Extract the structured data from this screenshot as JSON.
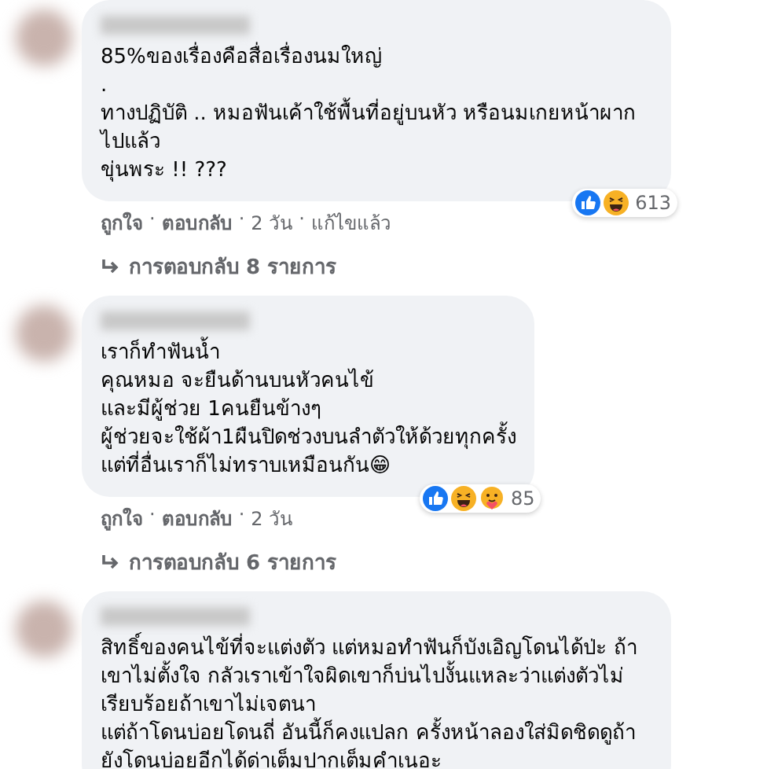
{
  "separator": "·",
  "comments": [
    {
      "lines": [
        "85%ของเรื่องคือสื่อเรื่องนมใหญ่",
        ".",
        "ทางปฏิบัติ .. หมอฟันเค้าใช้พื้นที่อยู่บนหัว หรือนมเกยหน้าผากไปแล้ว",
        "ขุ่นพระ !! ???"
      ],
      "reactions": [
        {
          "kind": "like"
        },
        {
          "kind": "haha"
        }
      ],
      "count": "613",
      "actions": [
        "ถูกใจ",
        "ตอบกลับ",
        "2 วัน",
        "แก้ไขแล้ว"
      ],
      "replies": "การตอบกลับ 8 รายการ"
    },
    {
      "lines": [
        "เราก็ทำฟันนํ้า",
        "คุณหมอ จะยืนด้านบนหัวคนไข้",
        "และมีผู้ช่วย 1คนยืนข้างๆ",
        "ผู้ช่วยจะใช้ผ้า1ผืนปิดช่วงบนลำตัวให้ด้วยทุกครั้ง",
        "แต่ที่อื่นเราก็ไม่ทราบเหมือนกัน😁"
      ],
      "reactions": [
        {
          "kind": "like"
        },
        {
          "kind": "haha"
        },
        {
          "kind": "care"
        }
      ],
      "count": "85",
      "actions": [
        "ถูกใจ",
        "ตอบกลับ",
        "2 วัน"
      ],
      "replies": "การตอบกลับ 6 รายการ"
    },
    {
      "lines": [
        "สิทธิ์ของคนไข้ที่จะแต่งตัว แต่หมอทำฟันก็บังเอิญโดนได้ป่ะ ถ้าเขาไม่ตั้งใจ กลัวเราเข้าใจผิดเขาก็บ่นไปงั้นแหละว่าแต่งตัวไม่เรียบร้อยถ้าเขาไม่เจตนา",
        "แต่ถ้าโดนบ่อยโดนถี่ อันนี้ก็คงแปลก ครั้งหน้าลองใส่มิดชิดดูถ้ายังโดนบ่อยอีกได้ด่าเต็มปากเต็มคำเนอะ"
      ]
    }
  ]
}
